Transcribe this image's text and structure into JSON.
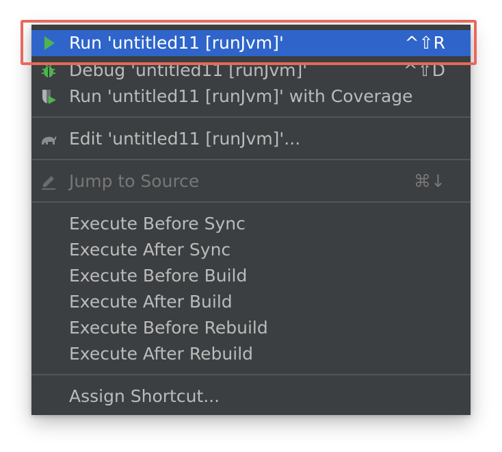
{
  "menu": {
    "items": [
      {
        "label": "Run 'untitled11 [runJvm]'",
        "shortcut": "^⇧R",
        "icon": "run-icon",
        "state": "selected"
      },
      {
        "label": "Debug 'untitled11 [runJvm]'",
        "shortcut": "^⇧D",
        "icon": "debug-icon",
        "state": "normal"
      },
      {
        "label": "Run 'untitled11 [runJvm]' with Coverage",
        "shortcut": "",
        "icon": "coverage-icon",
        "state": "normal"
      },
      {
        "label": "Edit 'untitled11 [runJvm]'...",
        "shortcut": "",
        "icon": "gradle-icon",
        "state": "normal"
      },
      {
        "label": "Jump to Source",
        "shortcut": "⌘↓",
        "icon": "edit-pencil-icon",
        "state": "disabled"
      },
      {
        "label": "Execute Before Sync",
        "shortcut": "",
        "icon": "",
        "state": "normal"
      },
      {
        "label": "Execute After Sync",
        "shortcut": "",
        "icon": "",
        "state": "normal"
      },
      {
        "label": "Execute Before Build",
        "shortcut": "",
        "icon": "",
        "state": "normal"
      },
      {
        "label": "Execute After Build",
        "shortcut": "",
        "icon": "",
        "state": "normal"
      },
      {
        "label": "Execute Before Rebuild",
        "shortcut": "",
        "icon": "",
        "state": "normal"
      },
      {
        "label": "Execute After Rebuild",
        "shortcut": "",
        "icon": "",
        "state": "normal"
      },
      {
        "label": "Assign Shortcut...",
        "shortcut": "",
        "icon": "",
        "state": "normal"
      }
    ]
  },
  "colors": {
    "menu_background": "#3c3f41",
    "selection": "#2f65ca",
    "text": "#bbbbbb",
    "disabled_text": "#777777",
    "highlight_outline": "#e8685c"
  }
}
